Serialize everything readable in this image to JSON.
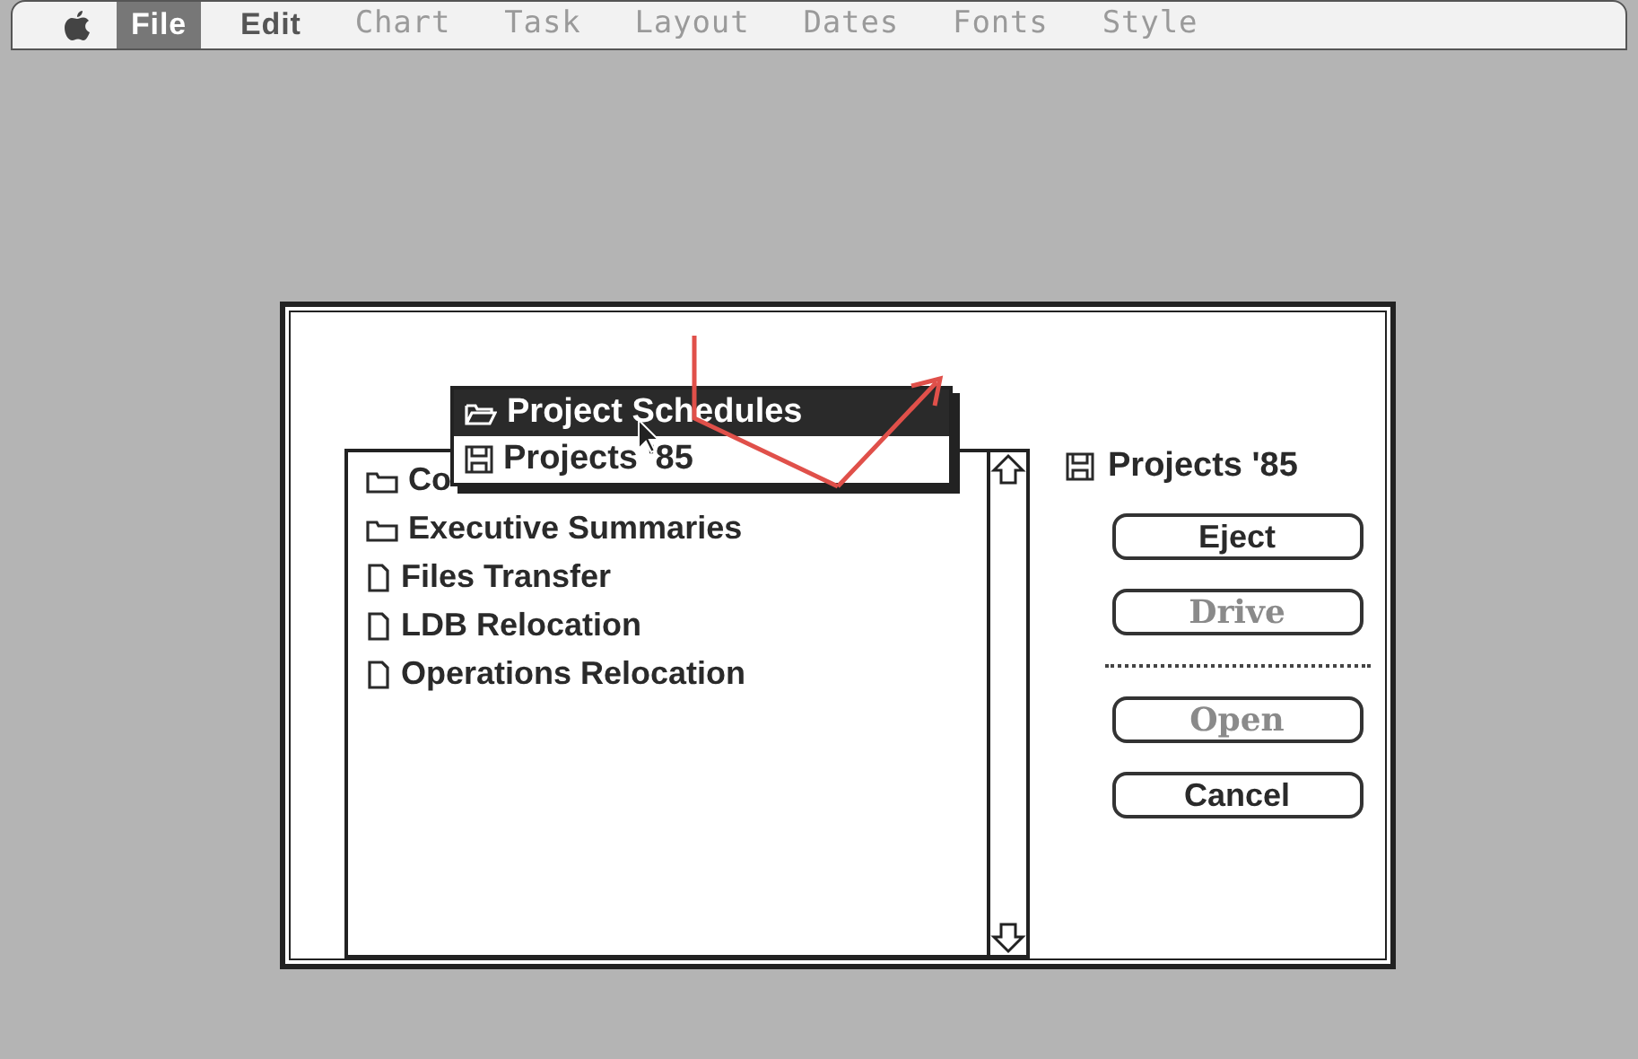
{
  "menu_bar": [
    {
      "label": "File",
      "selected": true,
      "disabled": false
    },
    {
      "label": "Edit",
      "selected": false,
      "disabled": false
    },
    {
      "label": "Chart",
      "selected": false,
      "disabled": true
    },
    {
      "label": "Task",
      "selected": false,
      "disabled": true
    },
    {
      "label": "Layout",
      "selected": false,
      "disabled": true
    },
    {
      "label": "Dates",
      "selected": false,
      "disabled": true
    },
    {
      "label": "Fonts",
      "selected": false,
      "disabled": true
    },
    {
      "label": "Style",
      "selected": false,
      "disabled": true
    }
  ],
  "popup": [
    {
      "label": "Project Schedules",
      "kind": "folder",
      "selected": true
    },
    {
      "label": "Projects '85",
      "kind": "disk",
      "selected": false
    }
  ],
  "files": [
    {
      "name": "Co",
      "kind": "folder"
    },
    {
      "name": "Executive Summaries",
      "kind": "folder"
    },
    {
      "name": "Files Transfer",
      "kind": "document"
    },
    {
      "name": "LDB Relocation",
      "kind": "document"
    },
    {
      "name": "Operations Relocation",
      "kind": "document"
    }
  ],
  "disk_name": "Projects '85",
  "buttons": [
    {
      "label": "Eject",
      "disabled": false
    },
    {
      "label": "Drive",
      "disabled": true
    },
    {
      "label": "Open",
      "disabled": true
    },
    {
      "label": "Cancel",
      "disabled": false
    }
  ]
}
